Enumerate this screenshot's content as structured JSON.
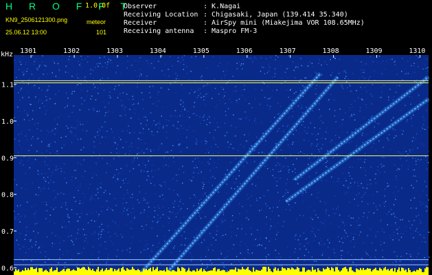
{
  "header": {
    "logo": "H R O F F T",
    "version": "1.0.0f",
    "filename": "KN9_2506121300.png",
    "datetime": "25.06.12 13:00",
    "mode_label": "meteor",
    "count": "101",
    "info": [
      {
        "label": "Observer",
        "value": ": K.Nagai"
      },
      {
        "label": "Receiving Location",
        "value": ": Chigasaki, Japan (139.414 35.340)"
      },
      {
        "label": "Receiver",
        "value": ": AirSpy mini (Miakejima VOR 108.65MHz)"
      },
      {
        "label": "Receiving antenna",
        "value": ": Maspro FM-3"
      }
    ]
  },
  "colors": {
    "background": "#000000",
    "spectrogram_base": "#0a2a8a",
    "trail": "#3aa0ff",
    "carrier_line": "#ffff60",
    "signal_band": "#ffff00",
    "accent": "#ffff00",
    "logo": "#00ff80"
  },
  "chart_data": {
    "type": "heatmap",
    "title": "",
    "ylabel": "kHz",
    "xlabel": "",
    "x_ticks": [
      "1301",
      "1302",
      "1303",
      "1304",
      "1305",
      "1306",
      "1307",
      "1308",
      "1309",
      "1310"
    ],
    "y_ticks": [
      "1.1",
      "1.0",
      "0.9",
      "0.8",
      "0.7",
      "0.6"
    ],
    "y_tick_values": [
      1.1,
      1.0,
      0.9,
      0.8,
      0.7,
      0.6
    ],
    "ylim": [
      0.58,
      1.18
    ],
    "xlim": [
      1300.6,
      1310.2
    ],
    "horizontal_lines_khz": [
      1.11,
      1.104,
      0.905,
      0.622,
      0.608
    ],
    "trails": [
      {
        "start": [
          1303.5,
          0.58
        ],
        "end": [
          1307.7,
          1.13
        ]
      },
      {
        "start": [
          1304.1,
          0.58
        ],
        "end": [
          1308.1,
          1.12
        ]
      },
      {
        "start": [
          1306.9,
          0.78
        ],
        "end": [
          1310.2,
          1.06
        ]
      },
      {
        "start": [
          1307.1,
          0.84
        ],
        "end": [
          1310.2,
          1.12
        ]
      }
    ]
  }
}
